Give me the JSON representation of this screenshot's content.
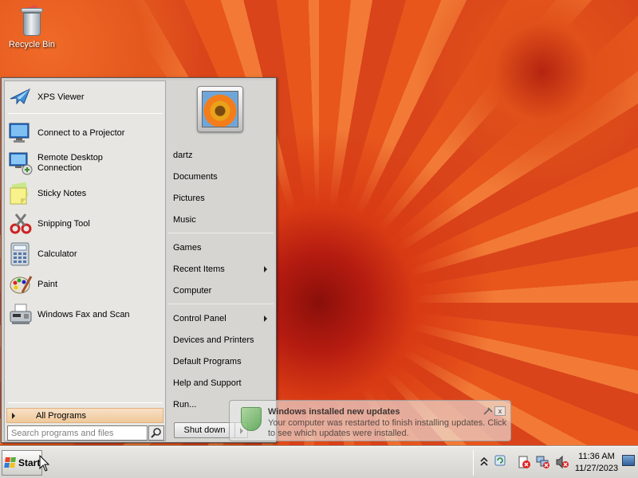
{
  "desktop": {
    "icons": [
      {
        "label": "Recycle Bin",
        "icon": "recycle-bin-icon"
      }
    ]
  },
  "start_menu": {
    "programs": [
      {
        "label": "XPS Viewer",
        "icon": "xps-viewer-icon"
      },
      {
        "label": "Connect to a Projector",
        "icon": "projector-icon"
      },
      {
        "label": "Remote Desktop\nConnection",
        "icon": "remote-desktop-icon"
      },
      {
        "label": "Sticky Notes",
        "icon": "sticky-notes-icon"
      },
      {
        "label": "Snipping Tool",
        "icon": "snipping-tool-icon"
      },
      {
        "label": "Calculator",
        "icon": "calculator-icon"
      },
      {
        "label": "Paint",
        "icon": "paint-icon"
      },
      {
        "label": "Windows Fax and Scan",
        "icon": "fax-scan-icon"
      }
    ],
    "all_programs": "All Programs",
    "search": {
      "placeholder": "Search programs and files",
      "value": ""
    },
    "right_items": [
      {
        "label": "dartz"
      },
      {
        "label": "Documents"
      },
      {
        "label": "Pictures"
      },
      {
        "label": "Music"
      },
      {
        "label": "Games"
      },
      {
        "label": "Recent Items",
        "submenu": true
      },
      {
        "label": "Computer"
      },
      {
        "label": "Control Panel",
        "submenu": true
      },
      {
        "label": "Devices and Printers"
      },
      {
        "label": "Default Programs"
      },
      {
        "label": "Help and Support"
      },
      {
        "label": "Run..."
      }
    ],
    "shutdown_label": "Shut down"
  },
  "notification": {
    "title": "Windows installed new updates",
    "text": "Your computer was restarted to finish installing updates. Click to see which updates were installed.",
    "close": "x"
  },
  "taskbar": {
    "start_label": "Start",
    "time": "11:36 AM",
    "date": "11/27/2023",
    "tray_icons": [
      "show-hidden-icons-icon",
      "windows-update-icon",
      "action-center-icon",
      "network-icon",
      "volume-muted-icon"
    ]
  },
  "colors": {
    "menu_highlight": "#f0c99a",
    "wallpaper": "#e2521c"
  }
}
